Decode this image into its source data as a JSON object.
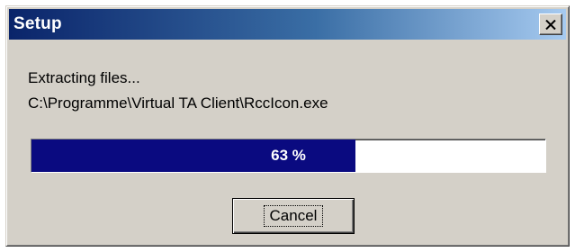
{
  "window": {
    "title": "Setup",
    "close_icon": "close-icon"
  },
  "status": {
    "action": "Extracting files...",
    "file_path": "C:\\Programme\\Virtual TA Client\\RccIcon.exe"
  },
  "progress": {
    "percent": 63,
    "label": "63 %",
    "fill_color": "#0a0a80"
  },
  "buttons": {
    "cancel_label": "Cancel"
  },
  "colors": {
    "title_bar_start": "#0a246a",
    "title_bar_end": "#a6caf0",
    "dialog_face": "#d4d0c8"
  }
}
